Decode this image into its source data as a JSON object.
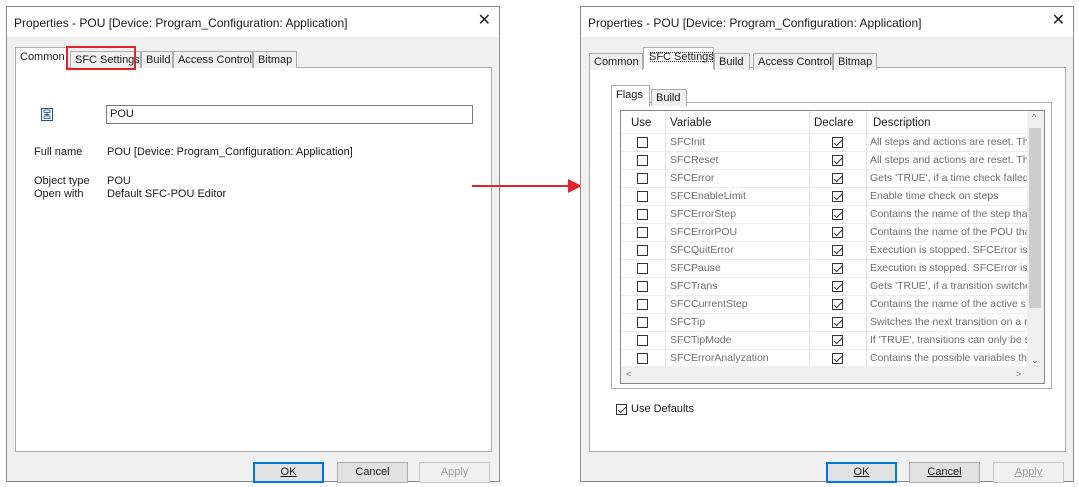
{
  "left_dialog": {
    "title": "Properties - POU [Device: Program_Configuration: Application]",
    "tabs": [
      "Common",
      "SFC Settings",
      "Build",
      "Access Control",
      "Bitmap"
    ],
    "name_value": "POU",
    "full_name_label": "Full name",
    "full_name_value": "POU [Device: Program_Configuration: Application]",
    "object_type_label": "Object type",
    "object_type_value": "POU",
    "open_with_label": "Open with",
    "open_with_value": "Default SFC-POU Editor",
    "buttons": {
      "ok": "OK",
      "cancel": "Cancel",
      "apply": "Apply"
    }
  },
  "right_dialog": {
    "title": "Properties - POU [Device: Program_Configuration: Application]",
    "tabs": [
      "Common",
      "SFC Settings",
      "Build",
      "Access Control",
      "Bitmap"
    ],
    "subtabs": [
      "Flags",
      "Build"
    ],
    "columns": [
      "Use",
      "Variable",
      "Declare",
      "Description"
    ],
    "rows": [
      {
        "use": false,
        "variable": "SFCInit",
        "declare": true,
        "description": "All steps and actions are reset. Th"
      },
      {
        "use": false,
        "variable": "SFCReset",
        "declare": true,
        "description": "All steps and actions are reset. Th"
      },
      {
        "use": false,
        "variable": "SFCError",
        "declare": true,
        "description": "Gets 'TRUE', if a time check failed."
      },
      {
        "use": false,
        "variable": "SFCEnableLimit",
        "declare": true,
        "description": "Enable time check on steps"
      },
      {
        "use": false,
        "variable": "SFCErrorStep",
        "declare": true,
        "description": "Contains the name of the step tha"
      },
      {
        "use": false,
        "variable": "SFCErrorPOU",
        "declare": true,
        "description": "Contains the name of the POU tha"
      },
      {
        "use": false,
        "variable": "SFCQuitError",
        "declare": true,
        "description": "Execution is stopped. SFCError is r"
      },
      {
        "use": false,
        "variable": "SFCPause",
        "declare": true,
        "description": "Execution is stopped. SFCError is r"
      },
      {
        "use": false,
        "variable": "SFCTrans",
        "declare": true,
        "description": "Gets 'TRUE', if a transition switche"
      },
      {
        "use": false,
        "variable": "SFCCurrentStep",
        "declare": true,
        "description": "Contains the name of the active s"
      },
      {
        "use": false,
        "variable": "SFCTip",
        "declare": true,
        "description": "Switches the next transition on a r"
      },
      {
        "use": false,
        "variable": "SFCTipMode",
        "declare": true,
        "description": "If 'TRUE', transitions can only be s"
      },
      {
        "use": false,
        "variable": "SFCErrorAnalyzation",
        "declare": true,
        "description": "Contains the possible variables tha"
      }
    ],
    "use_defaults_label": "Use Defaults",
    "use_defaults_checked": true,
    "buttons": {
      "ok": "OK",
      "cancel": "Cancel",
      "apply": "Apply"
    }
  },
  "colors": {
    "highlight": "#e3222b",
    "arrow": "#e3222b",
    "default_button_border": "#0078d7"
  },
  "icons": {
    "pou_icon": "sfc-pou-icon",
    "arrow": "right-arrow-icon"
  }
}
